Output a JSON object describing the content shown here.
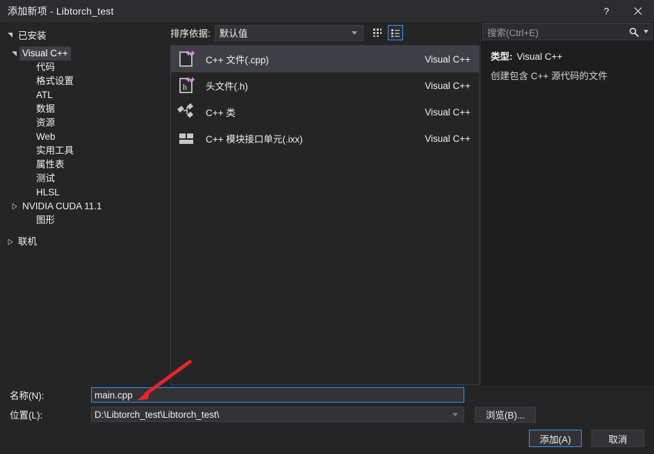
{
  "window": {
    "title": "添加新项 - Libtorch_test",
    "help_label": "?",
    "close_label": "✕"
  },
  "sidebar": {
    "header": "已安装",
    "items": [
      {
        "label": "Visual C++",
        "depth": 1,
        "expanded": true,
        "selected": true,
        "has_arrow": true
      },
      {
        "label": "代码",
        "depth": 2,
        "selected": false,
        "has_arrow": false
      },
      {
        "label": "格式设置",
        "depth": 2,
        "selected": false,
        "has_arrow": false
      },
      {
        "label": "ATL",
        "depth": 2,
        "selected": false,
        "has_arrow": false
      },
      {
        "label": "数据",
        "depth": 2,
        "selected": false,
        "has_arrow": false
      },
      {
        "label": "资源",
        "depth": 2,
        "selected": false,
        "has_arrow": false
      },
      {
        "label": "Web",
        "depth": 2,
        "selected": false,
        "has_arrow": false
      },
      {
        "label": "实用工具",
        "depth": 2,
        "selected": false,
        "has_arrow": false
      },
      {
        "label": "属性表",
        "depth": 2,
        "selected": false,
        "has_arrow": false
      },
      {
        "label": "测试",
        "depth": 2,
        "selected": false,
        "has_arrow": false
      },
      {
        "label": "HLSL",
        "depth": 2,
        "selected": false,
        "has_arrow": false
      },
      {
        "label": "NVIDIA CUDA 11.1",
        "depth": 1,
        "expanded": false,
        "selected": false,
        "has_arrow": true
      },
      {
        "label": "图形",
        "depth": 2,
        "selected": false,
        "has_arrow": false
      },
      {
        "label": "联机",
        "depth": 0,
        "expanded": false,
        "selected": false,
        "has_arrow": true,
        "gap": true
      }
    ]
  },
  "toolbar": {
    "sort_label": "排序依据:",
    "sort_value": "默认值",
    "view_grid_name": "grid-view",
    "view_list_name": "list-view",
    "active_view": "list"
  },
  "templates": {
    "rows": [
      {
        "name": "C++ 文件(.cpp)",
        "origin": "Visual C++",
        "icon": "cpp-file-icon",
        "selected": true
      },
      {
        "name": "头文件(.h)",
        "origin": "Visual C++",
        "icon": "header-file-icon",
        "selected": false
      },
      {
        "name": "C++ 类",
        "origin": "Visual C++",
        "icon": "cpp-class-icon",
        "selected": false
      },
      {
        "name": "C++ 模块接口单元(.ixx)",
        "origin": "Visual C++",
        "icon": "cpp-module-icon",
        "selected": false
      }
    ]
  },
  "search": {
    "placeholder": "搜索(Ctrl+E)"
  },
  "details": {
    "type_key": "类型:",
    "type_value": "Visual C++",
    "description": "创建包含 C++ 源代码的文件"
  },
  "fields": {
    "name_label": "名称(N):",
    "name_value": "main.cpp",
    "location_label": "位置(L):",
    "location_value": "D:\\Libtorch_test\\Libtorch_test\\",
    "browse_label": "浏览(B)..."
  },
  "actions": {
    "add_label": "添加(A)",
    "cancel_label": "取消"
  },
  "colors": {
    "dialog_bg": "#252526",
    "titlebar_bg": "#2d2d30",
    "panel_bg": "#1e1e1e",
    "selection_bg": "#3f3f46",
    "accent_blue": "#3399ff",
    "text": "#f1f1f1",
    "icon_purple": "#d58ee0",
    "annotation_red": "#e8242a"
  }
}
